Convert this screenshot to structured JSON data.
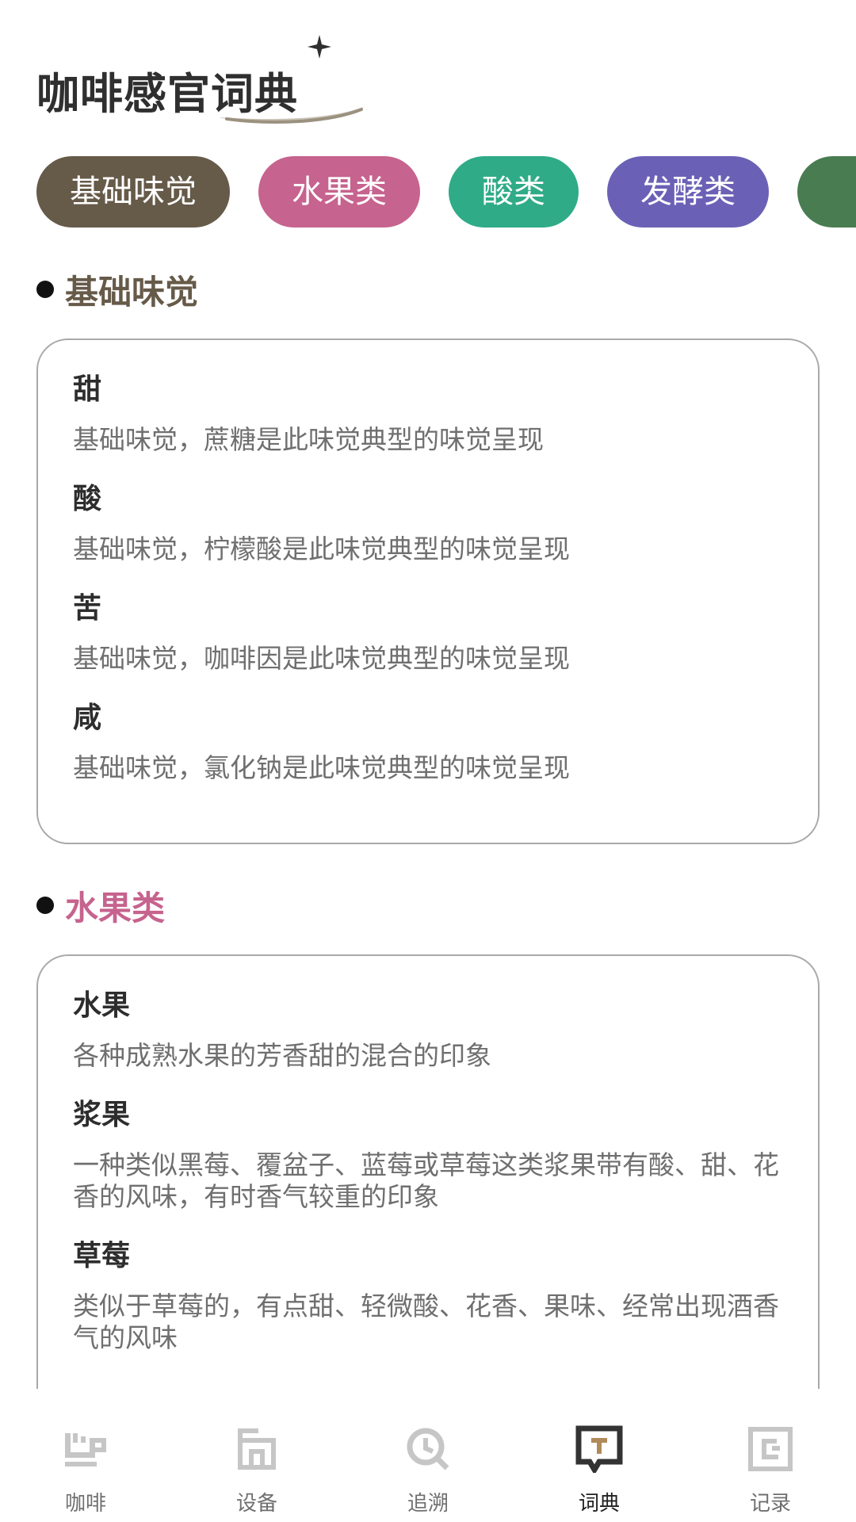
{
  "header": {
    "title": "咖啡感官词典"
  },
  "categories": [
    {
      "label": "基础味觉",
      "color": "#665a49"
    },
    {
      "label": "水果类",
      "color": "#c6638e"
    },
    {
      "label": "酸类",
      "color": "#2fab87"
    },
    {
      "label": "发酵类",
      "color": "#6a61b6"
    },
    {
      "label": "",
      "color": "#4a7c52"
    }
  ],
  "sections": [
    {
      "title": "基础味觉",
      "title_color": "#665a49",
      "terms": [
        {
          "name": "甜",
          "desc": "基础味觉，蔗糖是此味觉典型的味觉呈现"
        },
        {
          "name": "酸",
          "desc": "基础味觉，柠檬酸是此味觉典型的味觉呈现"
        },
        {
          "name": "苦",
          "desc": "基础味觉，咖啡因是此味觉典型的味觉呈现"
        },
        {
          "name": "咸",
          "desc": "基础味觉，氯化钠是此味觉典型的味觉呈现"
        }
      ]
    },
    {
      "title": "水果类",
      "title_color": "#c6638e",
      "terms": [
        {
          "name": "水果",
          "desc": "各种成熟水果的芳香甜的混合的印象"
        },
        {
          "name": "浆果",
          "desc": "一种类似黑莓、覆盆子、蓝莓或草莓这类浆果带有酸、甜、花香的风味，有时香气较重的印象"
        },
        {
          "name": "草莓",
          "desc": "类似于草莓的，有点甜、轻微酸、花香、果味、经常出现酒香气的风味"
        }
      ]
    }
  ],
  "nav": [
    {
      "label": "咖啡",
      "icon": "coffee-cup-icon",
      "active": false
    },
    {
      "label": "设备",
      "icon": "equipment-icon",
      "active": false
    },
    {
      "label": "追溯",
      "icon": "trace-icon",
      "active": false
    },
    {
      "label": "词典",
      "icon": "dictionary-icon",
      "active": true
    },
    {
      "label": "记录",
      "icon": "record-icon",
      "active": false
    }
  ],
  "colors": {
    "nav_inactive": "#c6c6c6",
    "nav_active": "#333333",
    "nav_active_accent": "#b08a5a"
  }
}
